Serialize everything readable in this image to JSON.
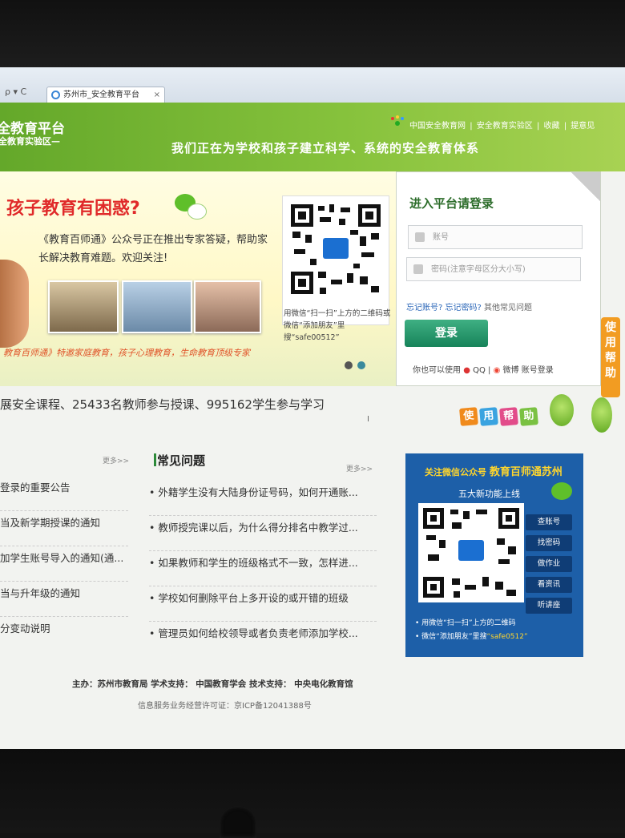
{
  "browser": {
    "tab_title": "苏州市_安全教育平台",
    "tab_close": "×",
    "nav_controls": "ρ ▾ C"
  },
  "header": {
    "title": "全教育平台",
    "subtitle": "全教育实验区—",
    "slogan": "我们正在为学校和孩子建立科学、系统的安全教育体系",
    "top_links": [
      "中国安全教育网",
      "|",
      "安全教育实验区",
      "|",
      "收藏",
      "|",
      "提意见"
    ]
  },
  "banner": {
    "headline": "孩子教育有困惑?",
    "text": "《教育百师通》公众号正在推出专家答疑，帮助家长解决教育难题。欢迎关注!",
    "footer": "教育百师通》特邀家庭教育，孩子心理教育，生命教育顶级专家",
    "qr_caption": "用微信“扫一扫”上方的二维码或微信“添加朋友”里搜“safe00512”"
  },
  "login": {
    "title": "进入平台请登录",
    "account_placeholder": "账号",
    "password_placeholder": "密码(注意字母区分大小写)",
    "forgot_account": "忘记账号?",
    "forgot_password": "忘记密码?",
    "faq": "其他常见问题",
    "button": "登录",
    "alt_prefix": "你也可以使用",
    "qq": "QQ",
    "weibo": "微博",
    "alt_suffix": "账号登录"
  },
  "help_side": "使用帮助",
  "help_blocks": [
    "使",
    "用",
    "帮",
    "助"
  ],
  "stats": "展安全课程、25433名教师参与授课、995162学生参与学习",
  "notices": {
    "more": "更多>>",
    "items": [
      "登录的重要公告",
      "当及新学期授课的通知",
      "加学生账号导入的通知(通...",
      "当与升年级的通知",
      "分变动说明"
    ]
  },
  "faq": {
    "title": "常见问题",
    "more": "更多>>",
    "items": [
      "外籍学生没有大陆身份证号码，如何开通账...",
      "教师授完课以后，为什么得分排名中教学过...",
      "如果教师和学生的班级格式不一致，怎样进...",
      "学校如何删除平台上多开设的或开错的班级",
      "管理员如何给校领导或者负责老师添加学校..."
    ]
  },
  "promo": {
    "title_prefix": "关注微信公众号",
    "title_name": "教育百师通苏州",
    "subtitle": "五大新功能上线",
    "buttons": [
      "查账号",
      "找密码",
      "做作业",
      "看资讯",
      "听讲座"
    ],
    "note1": "用微信“扫一扫”上方的二维码",
    "note2_prefix": "微信“添加朋友”里搜",
    "note2_id": "“safe0512”"
  },
  "footer": {
    "line1": "主办：苏州市教育局      学术支持：  中国教育学会   技术支持：  中央电化教育馆",
    "line2": "信息服务业务经营许可证：京ICP备12041388号"
  },
  "colors": {
    "header_green": "#86c23c",
    "headline_red": "#e02a2a",
    "login_green": "#17835a",
    "promo_blue": "#1d5fa8",
    "help_orange": "#f29c22"
  }
}
